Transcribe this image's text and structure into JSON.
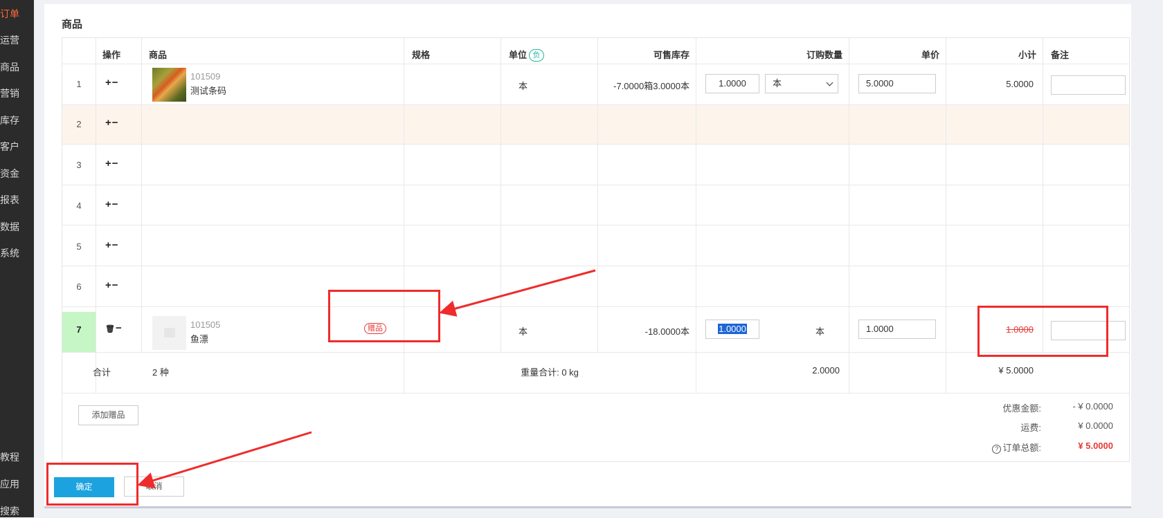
{
  "sidebar": {
    "items": [
      {
        "label": "订单",
        "active": true
      },
      {
        "label": "运营"
      },
      {
        "label": "商品"
      },
      {
        "label": "营销"
      },
      {
        "label": "库存"
      },
      {
        "label": "客户"
      },
      {
        "label": "资金"
      },
      {
        "label": "报表"
      },
      {
        "label": "数据"
      },
      {
        "label": "系统"
      }
    ],
    "bottom_items": [
      {
        "label": "教程"
      },
      {
        "label": "应用"
      },
      {
        "label": "搜索"
      }
    ]
  },
  "section_title": "商品",
  "table": {
    "headers": {
      "op": "操作",
      "product": "商品",
      "spec": "规格",
      "unit": "单位",
      "unit_badge": "负",
      "stock": "可售库存",
      "qty": "订购数量",
      "price": "单价",
      "subtotal": "小计",
      "remark": "备注"
    },
    "rows": [
      {
        "num": "1",
        "ops": "+−",
        "code": "101509",
        "name": "测试条码",
        "unit": "本",
        "stock": "-7.0000箱3.0000本",
        "qty": "1.0000",
        "qty_unit": "本",
        "price": "5.0000",
        "subtotal": "5.0000"
      },
      {
        "num": "2",
        "ops": "+−"
      },
      {
        "num": "3",
        "ops": "+−"
      },
      {
        "num": "4",
        "ops": "+−"
      },
      {
        "num": "5",
        "ops": "+−"
      },
      {
        "num": "6",
        "ops": "+−"
      },
      {
        "num": "7",
        "ops_trash": "🗑",
        "ops": "−",
        "code": "101505",
        "name": "鱼漂",
        "gift_tag": "赠品",
        "unit": "本",
        "stock": "-18.0000本",
        "qty": "1.0000",
        "qty_unit": "本",
        "price": "1.0000",
        "subtotal": "1.0000"
      }
    ],
    "total_row": {
      "label": "合计",
      "kinds": "2 种",
      "weight": "重量合计: 0 kg",
      "qty": "2.0000",
      "amount": "¥ 5.0000"
    }
  },
  "summary": {
    "add_gift_button": "添加赠品",
    "discount_label": "优惠金额:",
    "discount_value": "- ¥ 0.0000",
    "shipping_label": "运费:",
    "shipping_value": "¥ 0.0000",
    "help_icon": "?",
    "total_label": "订单总额:",
    "total_value": "¥ 5.0000"
  },
  "actions": {
    "confirm": "确定",
    "cancel": "取消"
  },
  "colors": {
    "sidebar_bg": "#2b2b2b",
    "active": "#ff6a3d",
    "primary": "#1ca3df",
    "annotation": "#ef2b2b",
    "row_highlight": "#fdf5ec",
    "row7_num_bg": "#c6f5c6"
  }
}
